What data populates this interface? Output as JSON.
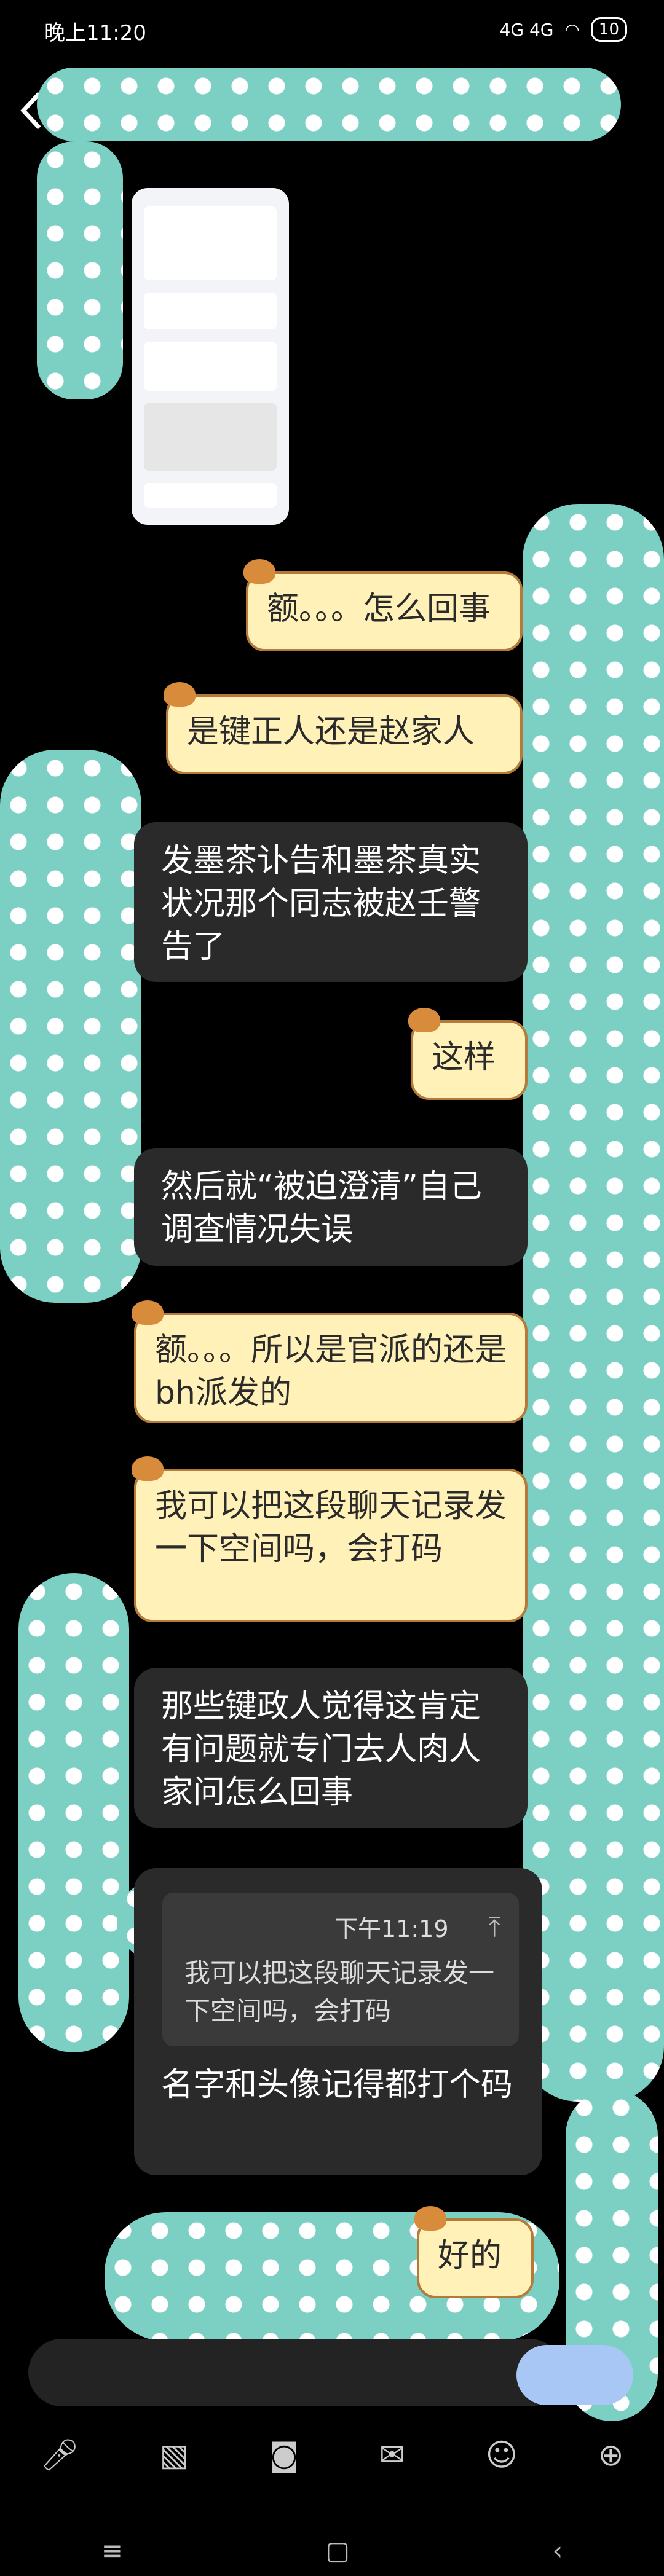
{
  "status": {
    "time": "晚上11:20",
    "signal": "4G 4G",
    "battery": "10"
  },
  "messages": {
    "m1": "额。。。怎么回事",
    "m2": "是键正人还是赵家人",
    "m3": "发墨茶讣告和墨茶真实状况那个同志被赵壬警告了",
    "m4": "这样",
    "m5": "然后就“被迫澄清”自己调查情况失误",
    "m6": "额。。。所以是官派的还是bh派发的",
    "m7": "我可以把这段聊天记录发一下空间吗，会打码",
    "m8": "那些键政人觉得这肯定有问题就专门去人肉人家问怎么回事",
    "m9_quote_time": "下午11:19",
    "m9_quote": "我可以把这段聊天记录发一下空间吗，会打码",
    "m9": "名字和头像记得都打个码",
    "m10": "好的"
  },
  "icons": [
    "microphone-icon",
    "image-icon",
    "camera-icon",
    "red-packet-icon",
    "emoji-icon",
    "plus-icon"
  ],
  "nav": {
    "menu": "≡",
    "home": "▢",
    "back": "‹"
  }
}
